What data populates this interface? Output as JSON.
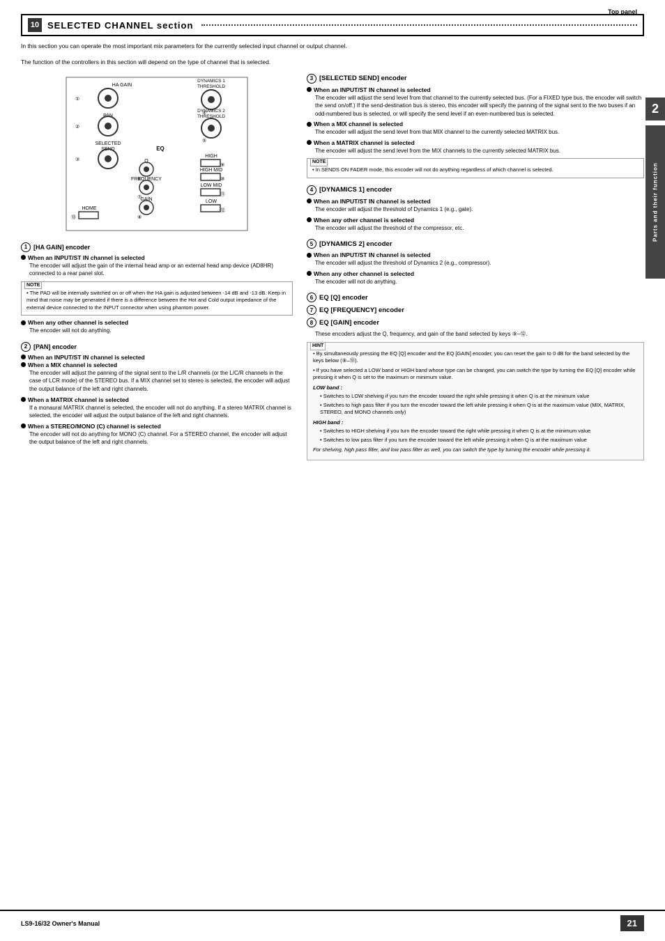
{
  "page": {
    "top_label": "Top panel",
    "side_tab_text": "Parts and their function",
    "side_number": "2",
    "bottom_model": "LS9-16/32  Owner's Manual",
    "bottom_page": "21"
  },
  "section10": {
    "number": "10",
    "title": "SELECTED CHANNEL section",
    "intro1": "In this section you can operate the most important mix parameters for the currently selected input channel or output channel.",
    "intro2": "The function of the controllers in this section will depend on the type of channel that is selected."
  },
  "encoders": {
    "ha_gain": {
      "number": "1",
      "title": "[HA GAIN] encoder",
      "subs": [
        {
          "title": "When an INPUT/ST IN channel is selected",
          "text": "The encoder will adjust the gain of the internal head amp or an external head amp device (AD8HR) connected to a rear panel slot."
        }
      ],
      "note": {
        "label": "NOTE",
        "text": "• The PAD will be internally switched on or off when the HA gain is adjusted between -14 dB and -13 dB. Keep in mind that noise may be generated if there is a difference between the Hot and Cold output impedance of the external device connected to the INPUT connector when using phantom power."
      },
      "other_channel": {
        "title": "When any other channel is selected",
        "text": "The encoder will not do anything."
      }
    },
    "pan": {
      "number": "2",
      "title": "[PAN] encoder",
      "subs": [
        {
          "title": "When an INPUT/ST IN channel is selected"
        },
        {
          "title": "When a MIX channel is selected",
          "combined": true,
          "text": "The encoder will adjust the panning of the signal sent to the L/R channels (or the L/C/R channels in the case of LCR mode) of the STEREO bus. If a MIX channel set to stereo is selected, the encoder will adjust the output balance of the left and right channels."
        },
        {
          "title": "When a MATRIX channel is selected",
          "text": "If a monaural MATRIX channel is selected, the encoder will not do anything. If a stereo MATRIX channel is selected, the encoder will adjust the output balance of the left and right channels."
        },
        {
          "title": "When a STEREO/MONO (C) channel is selected",
          "text": "The encoder will not do anything for MONO (C) channel. For a STEREO channel, the encoder will adjust the output balance of the left and right channels."
        }
      ]
    },
    "selected_send": {
      "number": "3",
      "title": "[SELECTED SEND] encoder",
      "subs": [
        {
          "title": "When an INPUT/ST IN channel is selected",
          "text": "The encoder will adjust the send level from that channel to the currently selected bus. (For a FIXED type bus, the encoder will switch the send on/off.) If the send-destination bus is stereo, this encoder will specify the panning of the signal sent to the two buses if an odd-numbered bus is selected, or will specify the send level if an even-numbered bus is selected."
        },
        {
          "title": "When a MIX channel is selected",
          "text": "The encoder will adjust the send level from that MIX channel to the currently selected MATRIX bus."
        },
        {
          "title": "When a MATRIX channel is selected",
          "text": "The encoder will adjust the send level from the MIX channels to the currently selected MATRIX bus."
        }
      ],
      "note": {
        "label": "NOTE",
        "text": "• In SENDS ON FADER mode, this encoder will not do anything regardless of which channel is selected."
      }
    },
    "dynamics1": {
      "number": "4",
      "title": "[DYNAMICS 1] encoder",
      "subs": [
        {
          "title": "When an INPUT/ST IN channel is selected",
          "text": "The encoder will adjust the threshold of Dynamics 1 (e.g., gate)."
        },
        {
          "title": "When any other channel is selected",
          "text": "The encoder will adjust the threshold of the compressor, etc."
        }
      ]
    },
    "dynamics2": {
      "number": "5",
      "title": "[DYNAMICS 2] encoder",
      "subs": [
        {
          "title": "When an INPUT/ST IN channel is selected",
          "text": "The encoder will adjust the threshold of Dynamics 2 (e.g., compressor)."
        },
        {
          "title": "When any other channel is selected",
          "text": "The encoder will not do anything."
        }
      ]
    },
    "eq_group": {
      "numbers": [
        "6",
        "7",
        "8"
      ],
      "titles": [
        "EQ [Q] encoder",
        "EQ [FREQUENCY] encoder",
        "EQ [GAIN] encoder"
      ],
      "text": "These encoders adjust the Q, frequency, and gain of the band selected by keys",
      "keys_ref": "9–12",
      "hint": {
        "label": "HINT",
        "items": [
          "By simultaneously pressing the EQ [Q] encoder and the EQ [GAIN] encoder, you can reset the gain to 0 dB for the band selected by the keys below (9–12).",
          "If you have selected a LOW band or HIGH band whose type can be changed, you can switch the type by turning the EQ [Q] encoder while pressing it when Q is set to the maximum or minimum value.",
          "LOW band :",
          "LOW_ITEM1: Switches to LOW shelving if you turn the encoder toward the right while pressing it when Q is at the minimum value",
          "LOW_ITEM2: Switches to high pass filter if you turn the encoder toward the left while pressing it when Q is at the maximum value (MIX, MATRIX, STEREO, and MONO channels only)",
          "HIGH band :",
          "HIGH_ITEM1: Switches to HIGH shelving if you turn the encoder toward the right while pressing it when Q is at the minimum value",
          "HIGH_ITEM2: Switches to low pass filter if you turn the encoder toward the left while pressing it when Q is at the maximum value",
          "For shelving, high pass filter, and low pass filter as well, you can switch the type by turning the encoder while pressing it."
        ]
      }
    }
  },
  "diagram": {
    "labels": {
      "ha_gain": "HA GAIN",
      "dynamics1_th": "DYNAMICS 1\nTHRESHOLD",
      "pan": "PAN",
      "dynamics2_th": "DYNAMICS 2\nTHRESHOLD",
      "selected_send": "SELECTED\nSEND",
      "eq": "EQ",
      "q": "Q",
      "high": "HIGH",
      "high_mid": "HIGH MID",
      "frequency": "FREQUENCY",
      "low_mid": "LOW MID",
      "home": "HOME",
      "gain": "GAIN",
      "low": "LOW"
    },
    "numbers": [
      "1",
      "2",
      "3",
      "4",
      "5",
      "6",
      "7",
      "8",
      "9",
      "10",
      "11",
      "12",
      "13"
    ]
  }
}
